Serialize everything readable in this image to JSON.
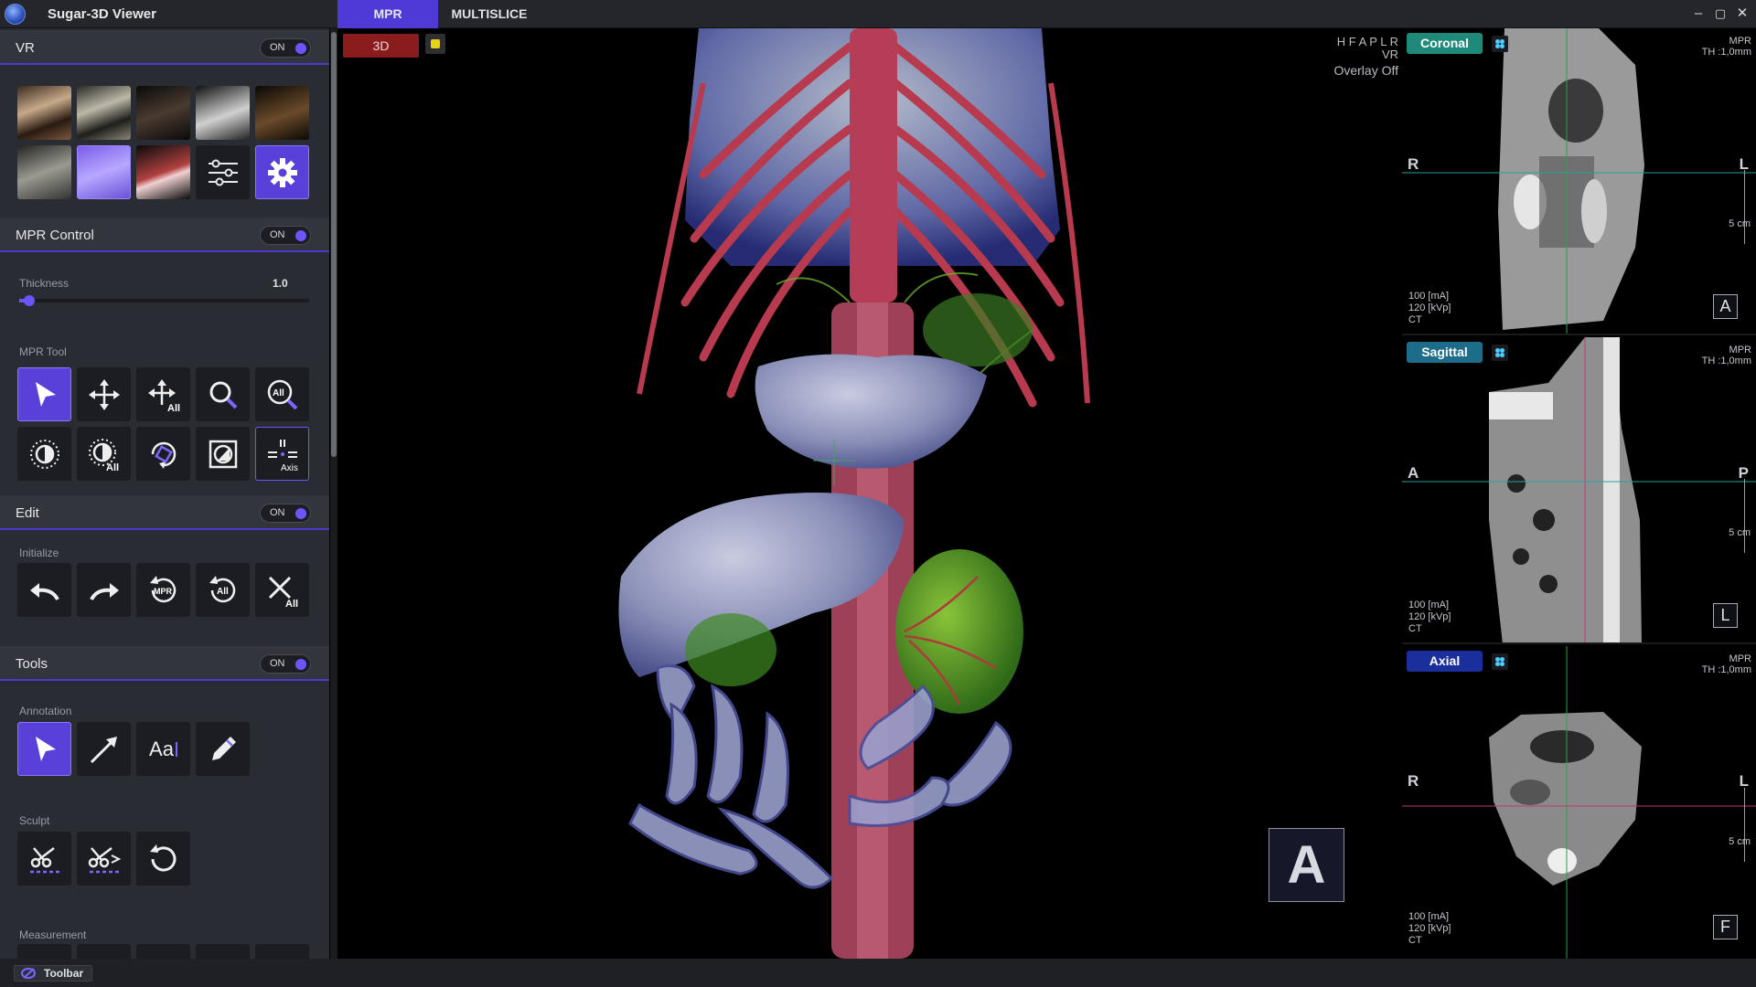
{
  "titlebar": {
    "title": "Sugar-3D Viewer",
    "tabs": [
      "MPR",
      "MULTISLICE"
    ],
    "minimize": "–",
    "maximize": "▢",
    "close": "✕"
  },
  "sidebar": {
    "vr": {
      "title": "VR",
      "toggle": "ON"
    },
    "mpr_control": {
      "title": "MPR Control",
      "toggle": "ON",
      "thickness_label": "Thickness",
      "thickness_value": "1.0"
    },
    "mpr_tool": {
      "label": "MPR Tool",
      "all": "All",
      "axis": "Axis"
    },
    "edit": {
      "title": "Edit",
      "toggle": "ON",
      "initialize_label": "Initialize",
      "mpr_badge": "MPR",
      "all_badge": "All"
    },
    "tools": {
      "title": "Tools",
      "toggle": "ON",
      "annotation_label": "Annotation",
      "text_tool": "Aa",
      "sculpt_label": "Sculpt",
      "measurement_label": "Measurement"
    }
  },
  "statusbar": {
    "toolbar_label": "Toolbar"
  },
  "main_view": {
    "mode_button": "3D",
    "orient_line1": "H F A P L R",
    "orient_line2": "VR",
    "overlay": "Overlay Off",
    "orientation_cube": "A"
  },
  "mpr_views": [
    {
      "name": "Coronal",
      "color": "#1f8a7a",
      "mode": "MPR",
      "th": "TH :1,0mm",
      "left": "R",
      "right": "L",
      "scale": "5 cm",
      "ma": "100  [mA]",
      "kvp": "120  [kVp]",
      "modality": "CT",
      "orient": "A"
    },
    {
      "name": "Sagittal",
      "color": "#1d6d8a",
      "mode": "MPR",
      "th": "TH :1,0mm",
      "left": "A",
      "right": "P",
      "scale": "5 cm",
      "ma": "100  [mA]",
      "kvp": "120  [kVp]",
      "modality": "CT",
      "orient": "L"
    },
    {
      "name": "Axial",
      "color": "#1b2f9c",
      "mode": "MPR",
      "th": "TH :1,0mm",
      "left": "R",
      "right": "L",
      "scale": "5 cm",
      "ma": "100  [mA]",
      "kvp": "120  [kVp]",
      "modality": "CT",
      "orient": "F"
    }
  ]
}
